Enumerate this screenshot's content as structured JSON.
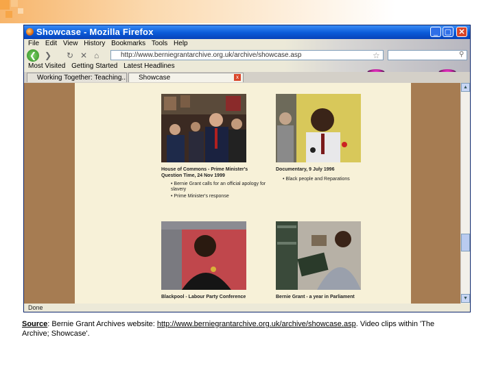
{
  "window": {
    "title": "Showcase - Mozilla Firefox",
    "min": "_",
    "max": "▢",
    "close": "✕"
  },
  "menu": [
    "File",
    "Edit",
    "View",
    "History",
    "Bookmarks",
    "Tools",
    "Help"
  ],
  "nav": {
    "back": "❮",
    "forward": "❯",
    "stop": "✕",
    "home": "⌂",
    "url": "http://www.berniegrantarchive.org.uk/archive/showcase.asp",
    "star": "☆"
  },
  "bookmarks": [
    "Most Visited",
    "Getting Started",
    "Latest Headlines"
  ],
  "tabs": [
    {
      "label": "Working Together: Teaching..."
    },
    {
      "label": "Showcase"
    }
  ],
  "tab_close": "x",
  "items": [
    {
      "title": "House of Commons - Prime Minister's Question Time, 24 Nov 1999",
      "bullets": [
        "Bernie Grant calls for an official apology for slavery",
        "Prime Minister's response"
      ]
    },
    {
      "title": "Documentary, 9 July 1996",
      "bullets": [
        "Black people and Reparations"
      ]
    },
    {
      "title": "Blackpool - Labour Party Conference",
      "bullets": []
    },
    {
      "title": "Bernie Grant - a year in Parliament",
      "bullets": []
    }
  ],
  "status": "Done",
  "source": {
    "label": "Source",
    "text": ": Bernie Grant Archives website: ",
    "url": "http://www.berniegrantarchive.org.uk/archive/showcase.asp",
    "tail": ". Video clips within 'The Archive; Showcase'."
  }
}
